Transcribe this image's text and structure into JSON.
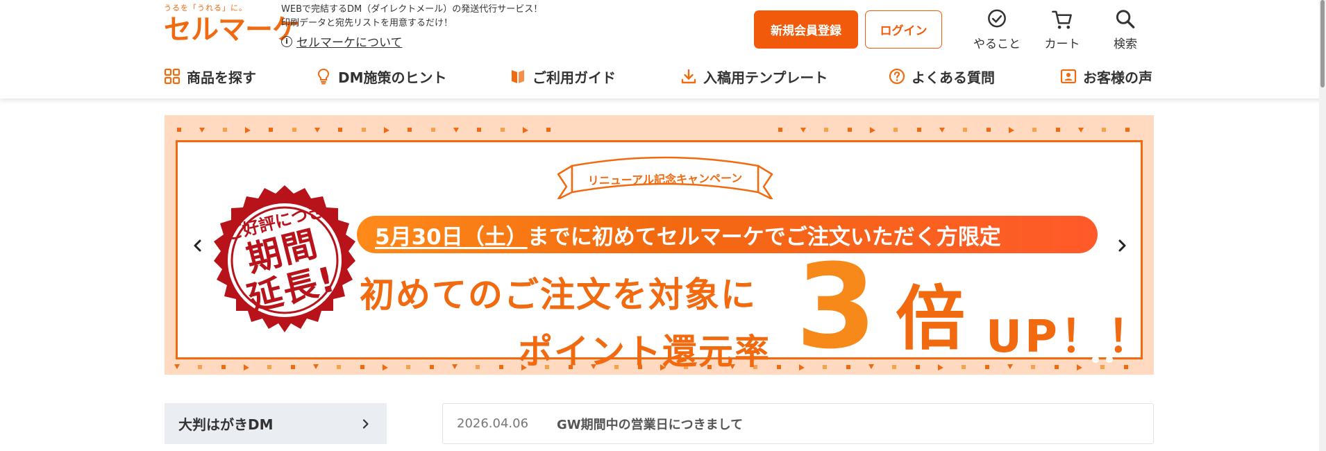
{
  "header": {
    "logo_tag": "うるを「うれる」に。",
    "logo_word": "セルマーケ",
    "tagline_line1": "WEBで完結するDM（ダイレクトメール）の発送代行サービス！",
    "tagline_line2": "印刷データと宛先リストを用意するだけ！",
    "about_label": "セルマーケについて",
    "register_label": "新規会員登録",
    "login_label": "ログイン",
    "utility": [
      {
        "label": "やること",
        "icon": "check-circle-icon"
      },
      {
        "label": "カート",
        "icon": "cart-icon"
      },
      {
        "label": "検索",
        "icon": "search-icon"
      }
    ]
  },
  "nav": [
    {
      "label": "商品を探す",
      "icon": "grid-icon"
    },
    {
      "label": "DM施策のヒント",
      "icon": "lightbulb-icon"
    },
    {
      "label": "ご利用ガイド",
      "icon": "book-icon"
    },
    {
      "label": "入稿用テンプレート",
      "icon": "download-icon"
    },
    {
      "label": "よくある質問",
      "icon": "question-icon"
    },
    {
      "label": "お客様の声",
      "icon": "voice-icon"
    }
  ],
  "banner": {
    "ribbon": "リニューアル記念キャンペーン",
    "stamp_line1": "ご好評につき",
    "stamp_line2": "期間",
    "stamp_line3": "延長!",
    "pill_date": "5月30日（土）",
    "pill_rest": "までに初めてセルマーケでご注文いただく方限定",
    "headline1": "初めてのご注文を対象に",
    "headline2": "ポイント還元率",
    "big_number": "3",
    "big_kanji": "倍",
    "big_up": "UP！！",
    "colors": {
      "accent": "#f26a10",
      "background": "#ffd9c0",
      "stamp": "#b8121a"
    }
  },
  "sidebar": {
    "item_label": "大判はがきDM"
  },
  "news": {
    "date": "2026.04.06",
    "title": "GW期間中の営業日につきまして"
  }
}
